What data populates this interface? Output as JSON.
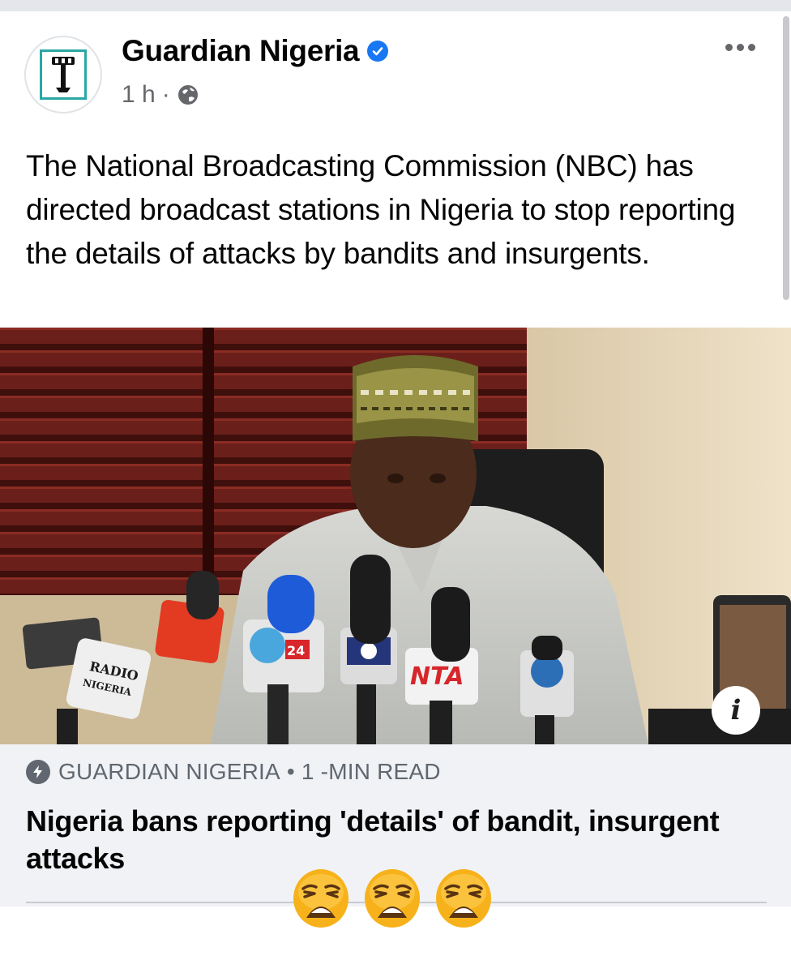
{
  "post": {
    "page_name": "Guardian Nigeria",
    "time": "1 h",
    "meta_separator": "·",
    "text": "The National Broadcasting Commission (NBC) has directed broadcast stations in Nigeria to stop reporting the details of attacks by bandits and insurgents."
  },
  "photo": {
    "info_label": "i",
    "mic_labels": [
      "RADIO NIGERIA",
      "24",
      "NTA"
    ]
  },
  "link_preview": {
    "source": "GUARDIAN NIGERIA",
    "separator": "•",
    "read_time": "1 -MIN READ",
    "title": "Nigeria bans reporting 'details' of bandit, insurgent attacks"
  },
  "reactions": {
    "emojis": [
      "weary-face",
      "weary-face",
      "weary-face"
    ]
  },
  "colors": {
    "verified": "#1877f2",
    "secondary_text": "#65676b",
    "preview_bg": "#f0f2f5",
    "emoji": "#f7b21b"
  }
}
